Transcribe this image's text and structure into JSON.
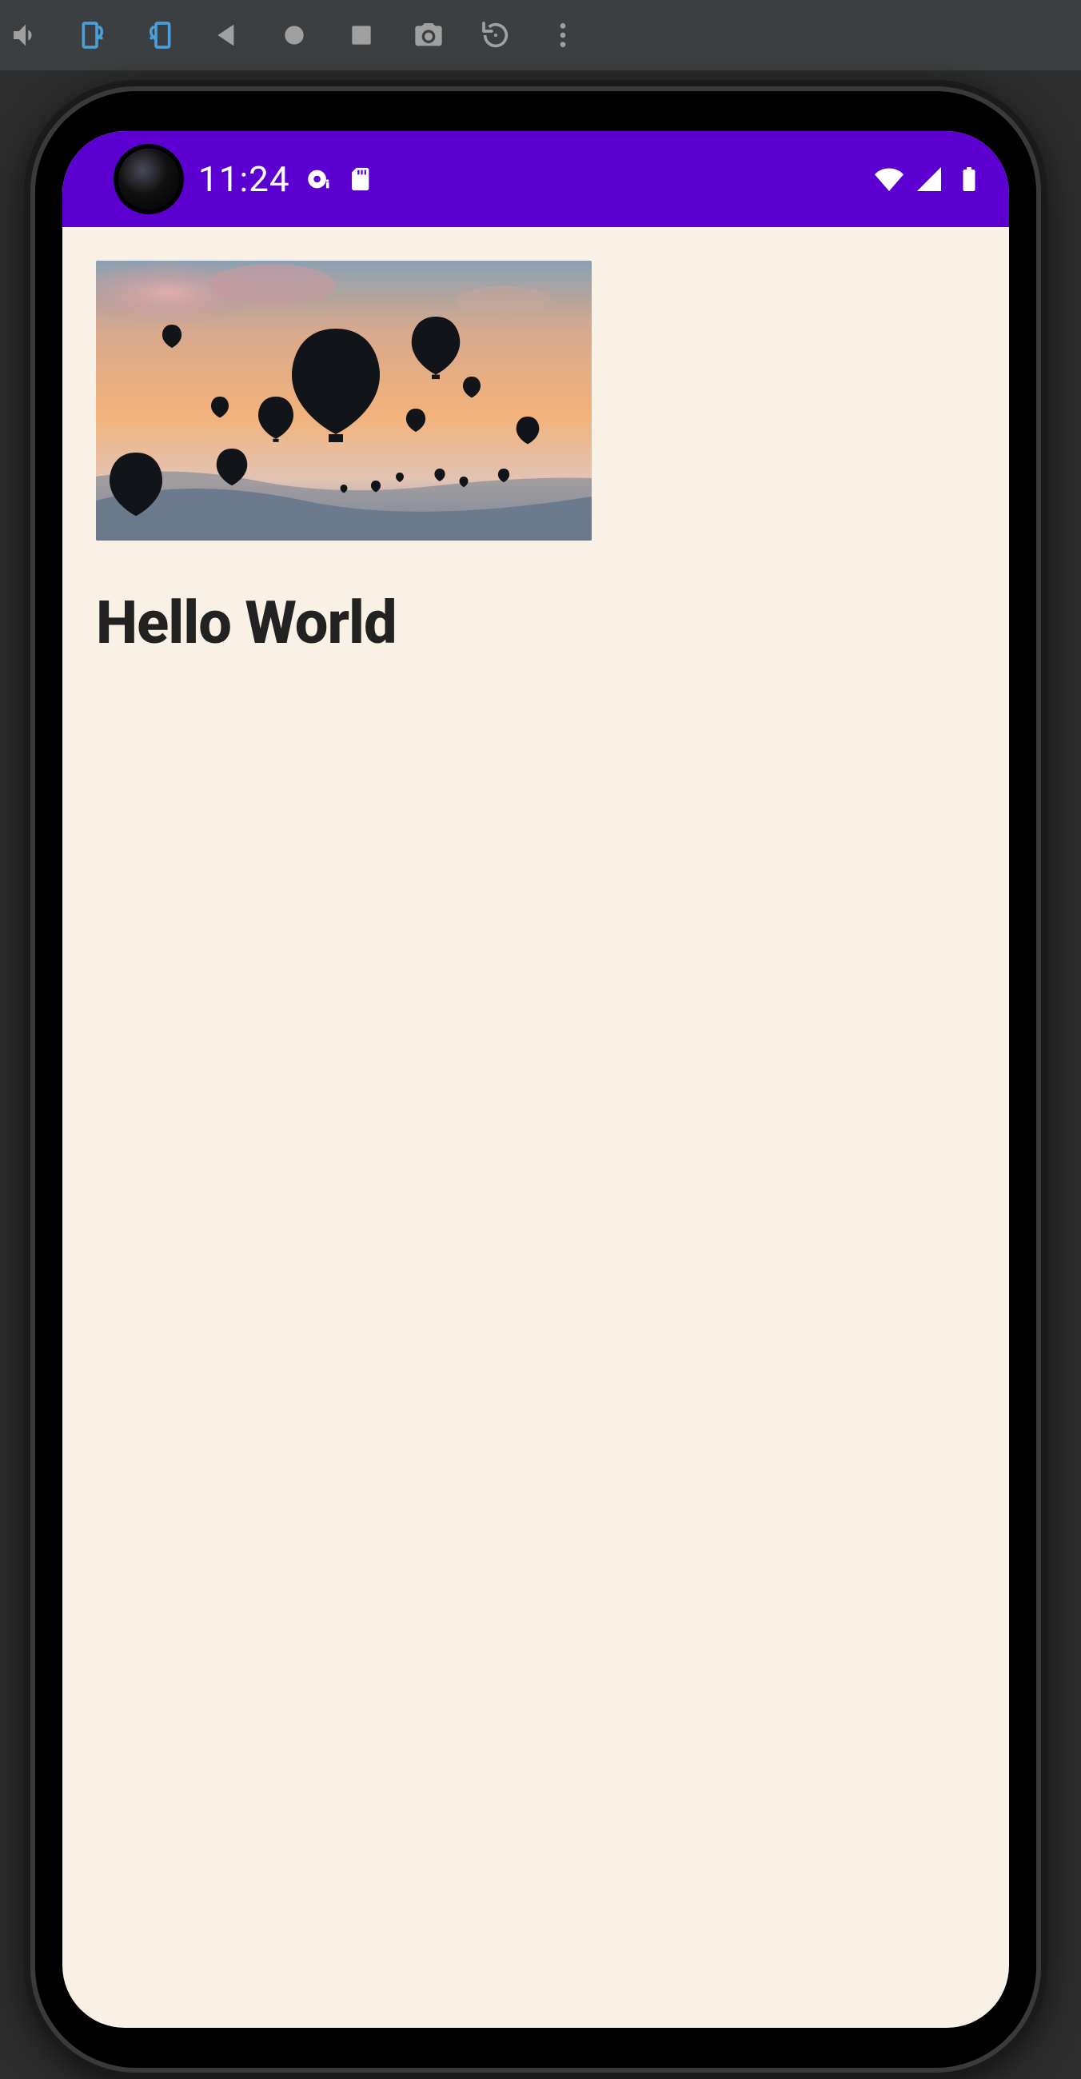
{
  "emulator_toolbar": {
    "icons": [
      {
        "name": "volume-icon"
      },
      {
        "name": "rotate-right-icon"
      },
      {
        "name": "rotate-left-icon"
      },
      {
        "name": "back-icon"
      },
      {
        "name": "home-icon"
      },
      {
        "name": "overview-icon"
      },
      {
        "name": "screenshot-icon"
      },
      {
        "name": "restart-icon"
      },
      {
        "name": "more-icon"
      }
    ]
  },
  "status_bar": {
    "time": "11:24",
    "left_icons": [
      "disc-icon",
      "sdcard-icon"
    ],
    "right_icons": [
      "wifi-icon",
      "signal-icon",
      "battery-icon"
    ],
    "background_color": "#5c00d2"
  },
  "app": {
    "hero_image_alt": "Hot air balloons at sunset",
    "title": "Hello World",
    "content_background": "#f9f0e6"
  }
}
